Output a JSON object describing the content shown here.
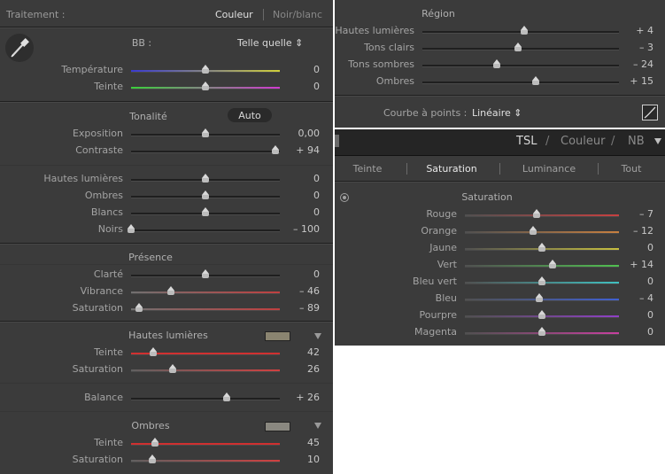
{
  "left": {
    "header": {
      "title": "Traitement :",
      "color_label": "Couleur",
      "bw_label": "Noir/blanc"
    },
    "wb": {
      "label": "BB :",
      "value": "Telle quelle ⇕"
    },
    "wb_sliders": [
      {
        "label": "Température",
        "value": "0",
        "pos": 0.5,
        "gradient": [
          "#3a3ad0",
          "#d0d03a"
        ]
      },
      {
        "label": "Teinte",
        "value": "0",
        "pos": 0.5,
        "gradient": [
          "#3ad03a",
          "#d03ad0"
        ]
      }
    ],
    "tone": {
      "label": "Tonalité",
      "auto_label": "Auto"
    },
    "tone_sliders": [
      {
        "label": "Exposition",
        "value": "0,00",
        "pos": 0.5,
        "gradient": [
          "#1f1f1f",
          "#1f1f1f"
        ]
      },
      {
        "label": "Contraste",
        "value": "+ 94",
        "pos": 0.97,
        "gradient": [
          "#1f1f1f",
          "#1f1f1f"
        ]
      }
    ],
    "tone_sliders2": [
      {
        "label": "Hautes lumières",
        "value": "0",
        "pos": 0.5,
        "gradient": [
          "#1f1f1f",
          "#1f1f1f"
        ]
      },
      {
        "label": "Ombres",
        "value": "0",
        "pos": 0.5,
        "gradient": [
          "#1f1f1f",
          "#1f1f1f"
        ]
      },
      {
        "label": "Blancs",
        "value": "0",
        "pos": 0.5,
        "gradient": [
          "#1f1f1f",
          "#1f1f1f"
        ]
      },
      {
        "label": "Noirs",
        "value": "– 100",
        "pos": 0.0,
        "gradient": [
          "#1f1f1f",
          "#1f1f1f"
        ]
      }
    ],
    "presence": {
      "label": "Présence"
    },
    "presence_sliders": [
      {
        "label": "Clarté",
        "value": "0",
        "pos": 0.5,
        "gradient": [
          "#1f1f1f",
          "#1f1f1f"
        ]
      },
      {
        "label": "Vibrance",
        "value": "– 46",
        "pos": 0.27,
        "gradient": [
          "#707070",
          "#c04040"
        ]
      },
      {
        "label": "Saturation",
        "value": "– 89",
        "pos": 0.055,
        "gradient": [
          "#707070",
          "#c04040"
        ]
      }
    ],
    "split": {
      "highlights_label": "Hautes lumières",
      "highlights_swatch": "#8a8470",
      "highlights_sliders": [
        {
          "label": "Teinte",
          "value": "42",
          "pos": 0.15,
          "gradient": [
            "#d03030",
            "#d03030"
          ]
        },
        {
          "label": "Saturation",
          "value": "26",
          "pos": 0.28,
          "gradient": [
            "#606060",
            "#d04040"
          ]
        }
      ],
      "balance": {
        "label": "Balance",
        "value": "+ 26",
        "pos": 0.64
      },
      "shadows_label": "Ombres",
      "shadows_swatch": "#8a8880",
      "shadows_sliders": [
        {
          "label": "Teinte",
          "value": "45",
          "pos": 0.16,
          "gradient": [
            "#d03030",
            "#d03030"
          ]
        },
        {
          "label": "Saturation",
          "value": "10",
          "pos": 0.14,
          "gradient": [
            "#606060",
            "#d04040"
          ]
        }
      ]
    }
  },
  "right": {
    "region": {
      "label": "Région"
    },
    "region_sliders": [
      {
        "label": "Hautes lumières",
        "value": "+ 4",
        "pos": 0.52
      },
      {
        "label": "Tons clairs",
        "value": "– 3",
        "pos": 0.485
      },
      {
        "label": "Tons sombres",
        "value": "– 24",
        "pos": 0.38
      },
      {
        "label": "Ombres",
        "value": "+ 15",
        "pos": 0.575
      }
    ],
    "curve": {
      "label": "Courbe à points :",
      "value": "Linéaire ⇕"
    },
    "hsl_header": {
      "tsl": "TSL",
      "sep1": "/",
      "couleur": "Couleur",
      "sep2": "/",
      "nb": "NB"
    },
    "tabs": [
      "Teinte",
      "Saturation",
      "Luminance",
      "Tout"
    ],
    "active_tab": 1,
    "saturation_title": "Saturation",
    "hsl_sliders": [
      {
        "label": "Rouge",
        "value": "– 7",
        "pos": 0.465,
        "color": "#c84040"
      },
      {
        "label": "Orange",
        "value": "– 12",
        "pos": 0.44,
        "color": "#c88040"
      },
      {
        "label": "Jaune",
        "value": "0",
        "pos": 0.5,
        "color": "#c8c040"
      },
      {
        "label": "Vert",
        "value": "+ 14",
        "pos": 0.57,
        "color": "#50c050"
      },
      {
        "label": "Bleu vert",
        "value": "0",
        "pos": 0.5,
        "color": "#40c0c0"
      },
      {
        "label": "Bleu",
        "value": "– 4",
        "pos": 0.48,
        "color": "#4060d0"
      },
      {
        "label": "Pourpre",
        "value": "0",
        "pos": 0.5,
        "color": "#9040c8"
      },
      {
        "label": "Magenta",
        "value": "0",
        "pos": 0.5,
        "color": "#c840a0"
      }
    ]
  }
}
